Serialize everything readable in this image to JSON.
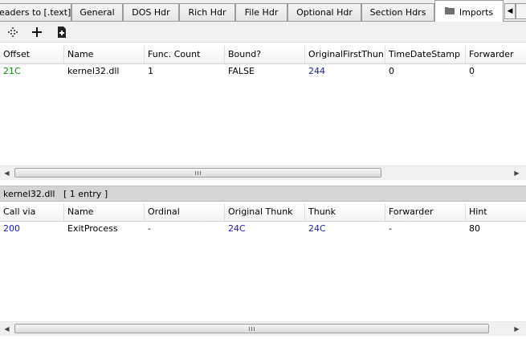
{
  "tabs": [
    {
      "label": "eaders to [.text]"
    },
    {
      "label": "General"
    },
    {
      "label": "DOS Hdr"
    },
    {
      "label": "Rich Hdr"
    },
    {
      "label": "File Hdr"
    },
    {
      "label": "Optional Hdr"
    },
    {
      "label": "Section Hdrs"
    },
    {
      "label": "Imports",
      "active": true,
      "icon": "folder-icon"
    }
  ],
  "tab_scroll": {
    "icon": "left-arrow-icon",
    "glyph": "◀"
  },
  "toolbar": {
    "buttons": [
      {
        "name": "move-icon"
      },
      {
        "name": "plus-icon"
      },
      {
        "name": "add-page-icon"
      }
    ]
  },
  "imports_table": {
    "columns": [
      "Offset",
      "Name",
      "Func. Count",
      "Bound?",
      "OriginalFirstThun",
      "TimeDateStamp",
      "Forwarder"
    ],
    "rows": [
      {
        "offset": "21C",
        "name": "kernel32.dll",
        "func_count": "1",
        "bound": "FALSE",
        "original_first_thunk": "244",
        "time_date_stamp": "0",
        "forwarder": "0"
      }
    ]
  },
  "selection_label": "kernel32.dll   [ 1 entry ]",
  "functions_table": {
    "columns": [
      "Call via",
      "Name",
      "Ordinal",
      "Original Thunk",
      "Thunk",
      "Forwarder",
      "Hint"
    ],
    "rows": [
      {
        "call_via": "200",
        "name": "ExitProcess",
        "ordinal": "-",
        "original_thunk": "24C",
        "thunk": "24C",
        "forwarder": "-",
        "hint": "80"
      }
    ]
  },
  "scrollbar": {
    "left_arrow": "◀",
    "right_arrow": "▶"
  },
  "colors": {
    "offset_green": "#0a8a0a",
    "link_blue": "#1a1ab8",
    "label_bar": "#d4d4d4"
  }
}
